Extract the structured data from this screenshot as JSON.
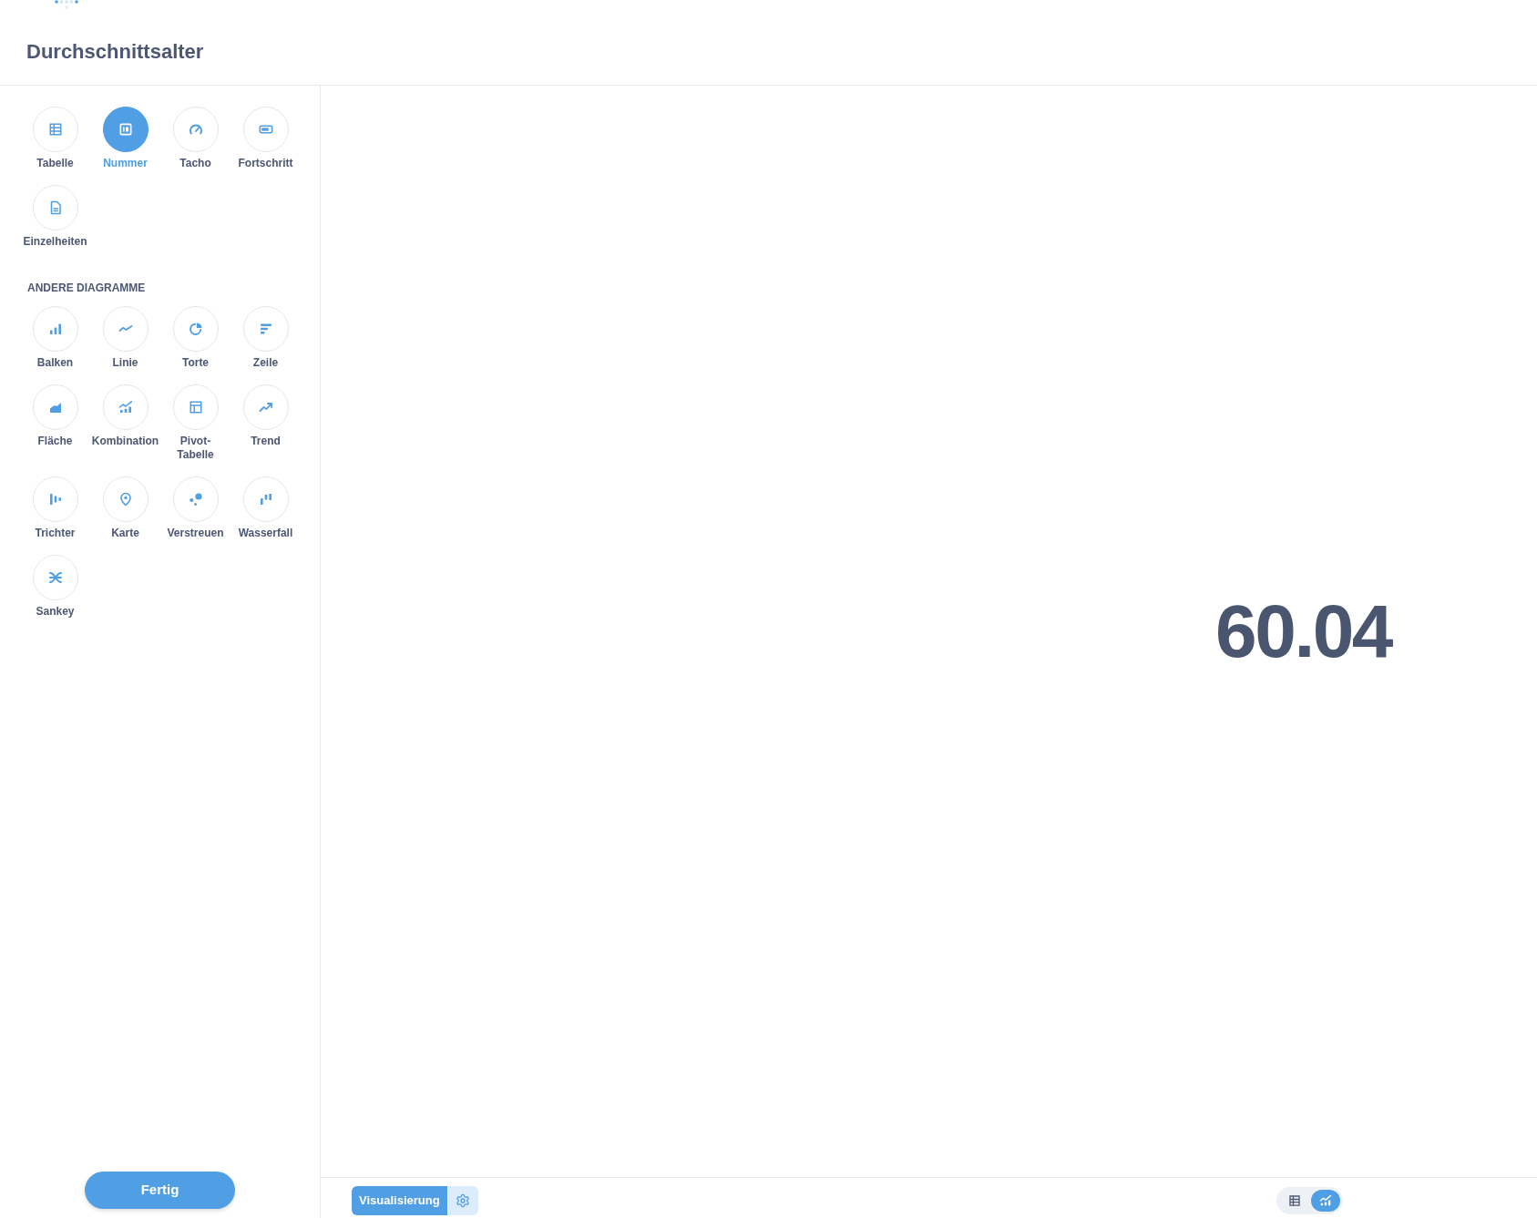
{
  "header": {
    "title": "Durchschnittsalter"
  },
  "sidebar": {
    "primary_types": [
      {
        "kind": "table",
        "label": "Tabelle",
        "selected": false
      },
      {
        "kind": "number",
        "label": "Nummer",
        "selected": true
      },
      {
        "kind": "gauge",
        "label": "Tacho",
        "selected": false
      },
      {
        "kind": "progress",
        "label": "Fortschritt",
        "selected": false
      },
      {
        "kind": "detail",
        "label": "Einzelheiten",
        "selected": false
      }
    ],
    "section_title": "ANDERE DIAGRAMME",
    "other_types": [
      {
        "kind": "bar",
        "label": "Balken",
        "selected": false
      },
      {
        "kind": "line",
        "label": "Linie",
        "selected": false
      },
      {
        "kind": "pie",
        "label": "Torte",
        "selected": false
      },
      {
        "kind": "row",
        "label": "Zeile",
        "selected": false
      },
      {
        "kind": "area",
        "label": "Fläche",
        "selected": false
      },
      {
        "kind": "combo",
        "label": "Kombination",
        "selected": false
      },
      {
        "kind": "pivot",
        "label": "Pivot-Tabelle",
        "selected": false
      },
      {
        "kind": "trend",
        "label": "Trend",
        "selected": false
      },
      {
        "kind": "funnel",
        "label": "Trichter",
        "selected": false
      },
      {
        "kind": "map",
        "label": "Karte",
        "selected": false
      },
      {
        "kind": "scatter",
        "label": "Verstreuen",
        "selected": false
      },
      {
        "kind": "waterfall",
        "label": "Wasserfall",
        "selected": false
      },
      {
        "kind": "sankey",
        "label": "Sankey",
        "selected": false
      }
    ],
    "done_button": "Fertig"
  },
  "main": {
    "value": "60.04"
  },
  "footer": {
    "visualization_button": "Visualisierung",
    "view_toggle": [
      {
        "kind": "table",
        "selected": false
      },
      {
        "kind": "chart",
        "selected": true
      }
    ]
  }
}
